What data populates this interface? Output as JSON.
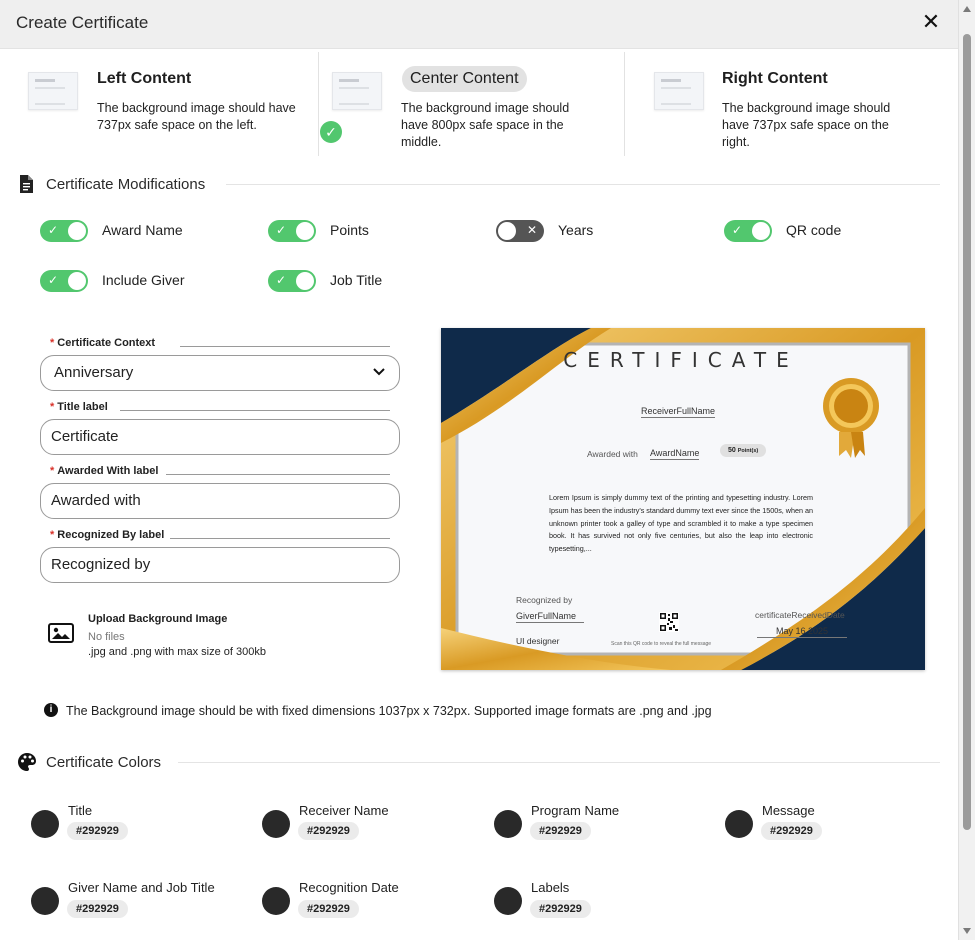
{
  "dialog": {
    "title": "Create Certificate",
    "close_glyph": "✕"
  },
  "layouts": [
    {
      "title": "Left Content",
      "description": "The background image should have 737px safe space on the left.",
      "selected": false
    },
    {
      "title": "Center Content",
      "description": "The background image should have 800px safe space in the middle.",
      "selected": true
    },
    {
      "title": "Right Content",
      "description": "The background image should have 737px safe space on the right.",
      "selected": false
    }
  ],
  "modifications": {
    "heading": "Certificate Modifications",
    "toggles": [
      {
        "label": "Award Name",
        "on": true
      },
      {
        "label": "Points",
        "on": true
      },
      {
        "label": "Years",
        "on": false
      },
      {
        "label": "QR code",
        "on": true
      },
      {
        "label": "Include Giver",
        "on": true
      },
      {
        "label": "Job Title",
        "on": true
      }
    ]
  },
  "form": {
    "context": {
      "label": "Certificate Context",
      "value": "Anniversary"
    },
    "title_label": {
      "label": "Title label",
      "value": "Certificate"
    },
    "awarded_with_label": {
      "label": "Awarded With label",
      "value": "Awarded with"
    },
    "recognized_by_label": {
      "label": "Recognized By label",
      "value": "Recognized by"
    },
    "required_mark": "*"
  },
  "upload": {
    "title": "Upload Background Image",
    "files": "No files",
    "hint": ".jpg and .png with max size of 300kb"
  },
  "info_text": "The Background image should be with fixed dimensions 1037px x 732px. Supported image formats are .png and .jpg",
  "certificate_preview": {
    "title": "CERTIFICATE",
    "receiver": "ReceiverFullName",
    "awarded_with": "Awarded with",
    "award_name": "AwardName",
    "points": "50",
    "points_unit": "Point(s)",
    "message": "Lorem Ipsum is simply dummy text of the printing and typesetting industry. Lorem Ipsum has been the industry's standard dummy text ever since the 1500s, when an unknown printer took a galley of type and scrambled it to make a type specimen book. It has survived not only five centuries, but also the leap into electronic typesetting,...",
    "recognized_by": "Recognized by",
    "giver": "GiverFullName",
    "job_title": "UI designer",
    "qr_caption": "Scan this QR code to reveal the full message",
    "date_label": "certificateReceivedDate",
    "date_value": "May 16 2025"
  },
  "colors": {
    "heading": "Certificate Colors",
    "items": [
      {
        "name": "Title",
        "hex": "#292929"
      },
      {
        "name": "Receiver Name",
        "hex": "#292929"
      },
      {
        "name": "Program Name",
        "hex": "#292929"
      },
      {
        "name": "Message",
        "hex": "#292929"
      },
      {
        "name": "Giver Name and Job Title",
        "hex": "#292929"
      },
      {
        "name": "Recognition Date",
        "hex": "#292929"
      },
      {
        "name": "Labels",
        "hex": "#292929"
      }
    ]
  },
  "theme": {
    "toggle_on": "#52c76e",
    "toggle_off": "#555555",
    "gold": "#e9b23a",
    "navy": "#0f2a4a"
  },
  "icons": [
    "close-icon",
    "document-icon",
    "palette-icon",
    "image-icon",
    "info-icon",
    "chevron-down-icon",
    "check-circle-icon"
  ]
}
